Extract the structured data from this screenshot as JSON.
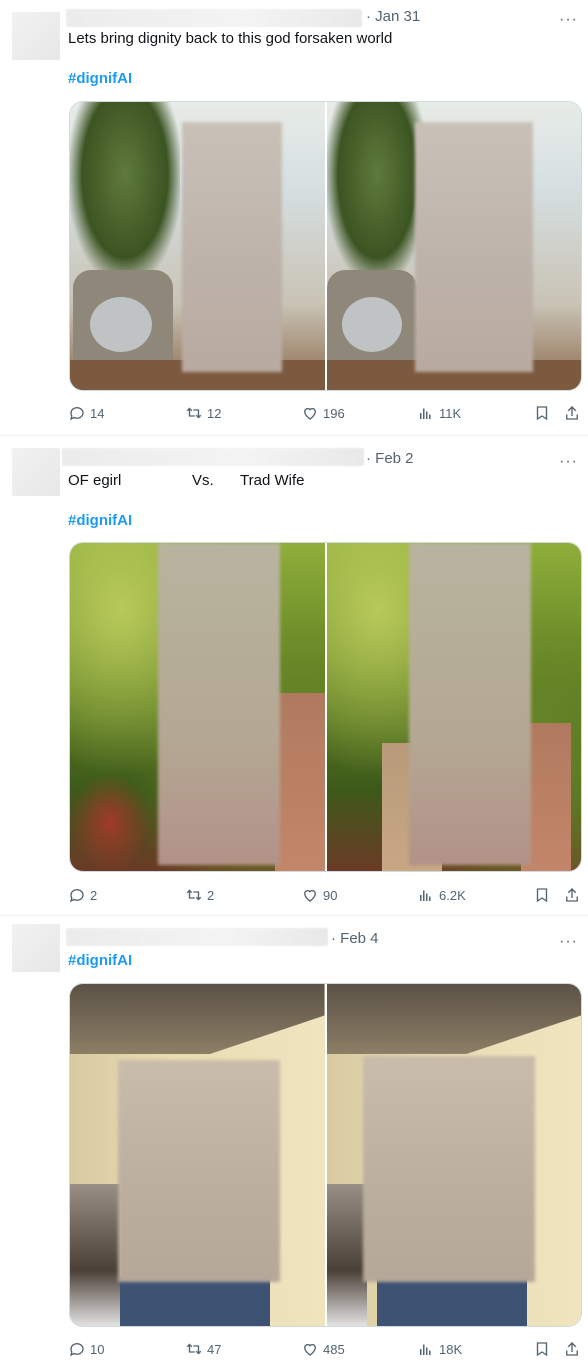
{
  "tweets": [
    {
      "date": "· Jan 31",
      "text": "Lets bring dignity back to this god forsaken world",
      "hashtag": "#dignifAI",
      "stats": {
        "replies": "14",
        "reposts": "12",
        "likes": "196",
        "views": "11K"
      }
    },
    {
      "date": "· Feb 2",
      "text_left": "OF egirl",
      "text_mid": "Vs.",
      "text_right": "Trad Wife",
      "hashtag": "#dignifAI",
      "stats": {
        "replies": "2",
        "reposts": "2",
        "likes": "90",
        "views": "6.2K"
      }
    },
    {
      "date": "· Feb 4",
      "hashtag": "#dignifAI",
      "stats": {
        "replies": "10",
        "reposts": "47",
        "likes": "485",
        "views": "18K"
      }
    }
  ],
  "more_label": "···",
  "icons": [
    "reply-icon",
    "repost-icon",
    "like-icon",
    "views-icon",
    "bookmark-icon",
    "share-icon"
  ]
}
